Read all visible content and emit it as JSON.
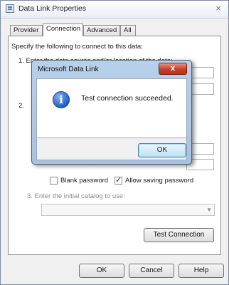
{
  "window": {
    "title": "Data Link Properties",
    "close_glyph": "×"
  },
  "tabs": [
    {
      "label": "Provider"
    },
    {
      "label": "Connection",
      "active": true
    },
    {
      "label": "Advanced"
    },
    {
      "label": "All"
    }
  ],
  "connection": {
    "instructions": "Specify the following to connect to this data:",
    "step1": "1. Enter the data source and/or location of the data:",
    "step2_prefix": "2.",
    "blank_password": {
      "label": "Blank password",
      "checked": false
    },
    "allow_saving": {
      "label": "Allow saving password",
      "checked": true
    },
    "step3": "3. Enter the initial catalog to use:",
    "catalog_value": "",
    "test_connection_label": "Test Connection"
  },
  "buttons": {
    "ok": "OK",
    "cancel": "Cancel",
    "help": "Help"
  },
  "message_box": {
    "title": "Microsoft Data Link",
    "close_glyph": "x",
    "icon": "info-icon",
    "icon_glyph": "i",
    "text": "Test connection succeeded.",
    "ok_label": "OK"
  }
}
